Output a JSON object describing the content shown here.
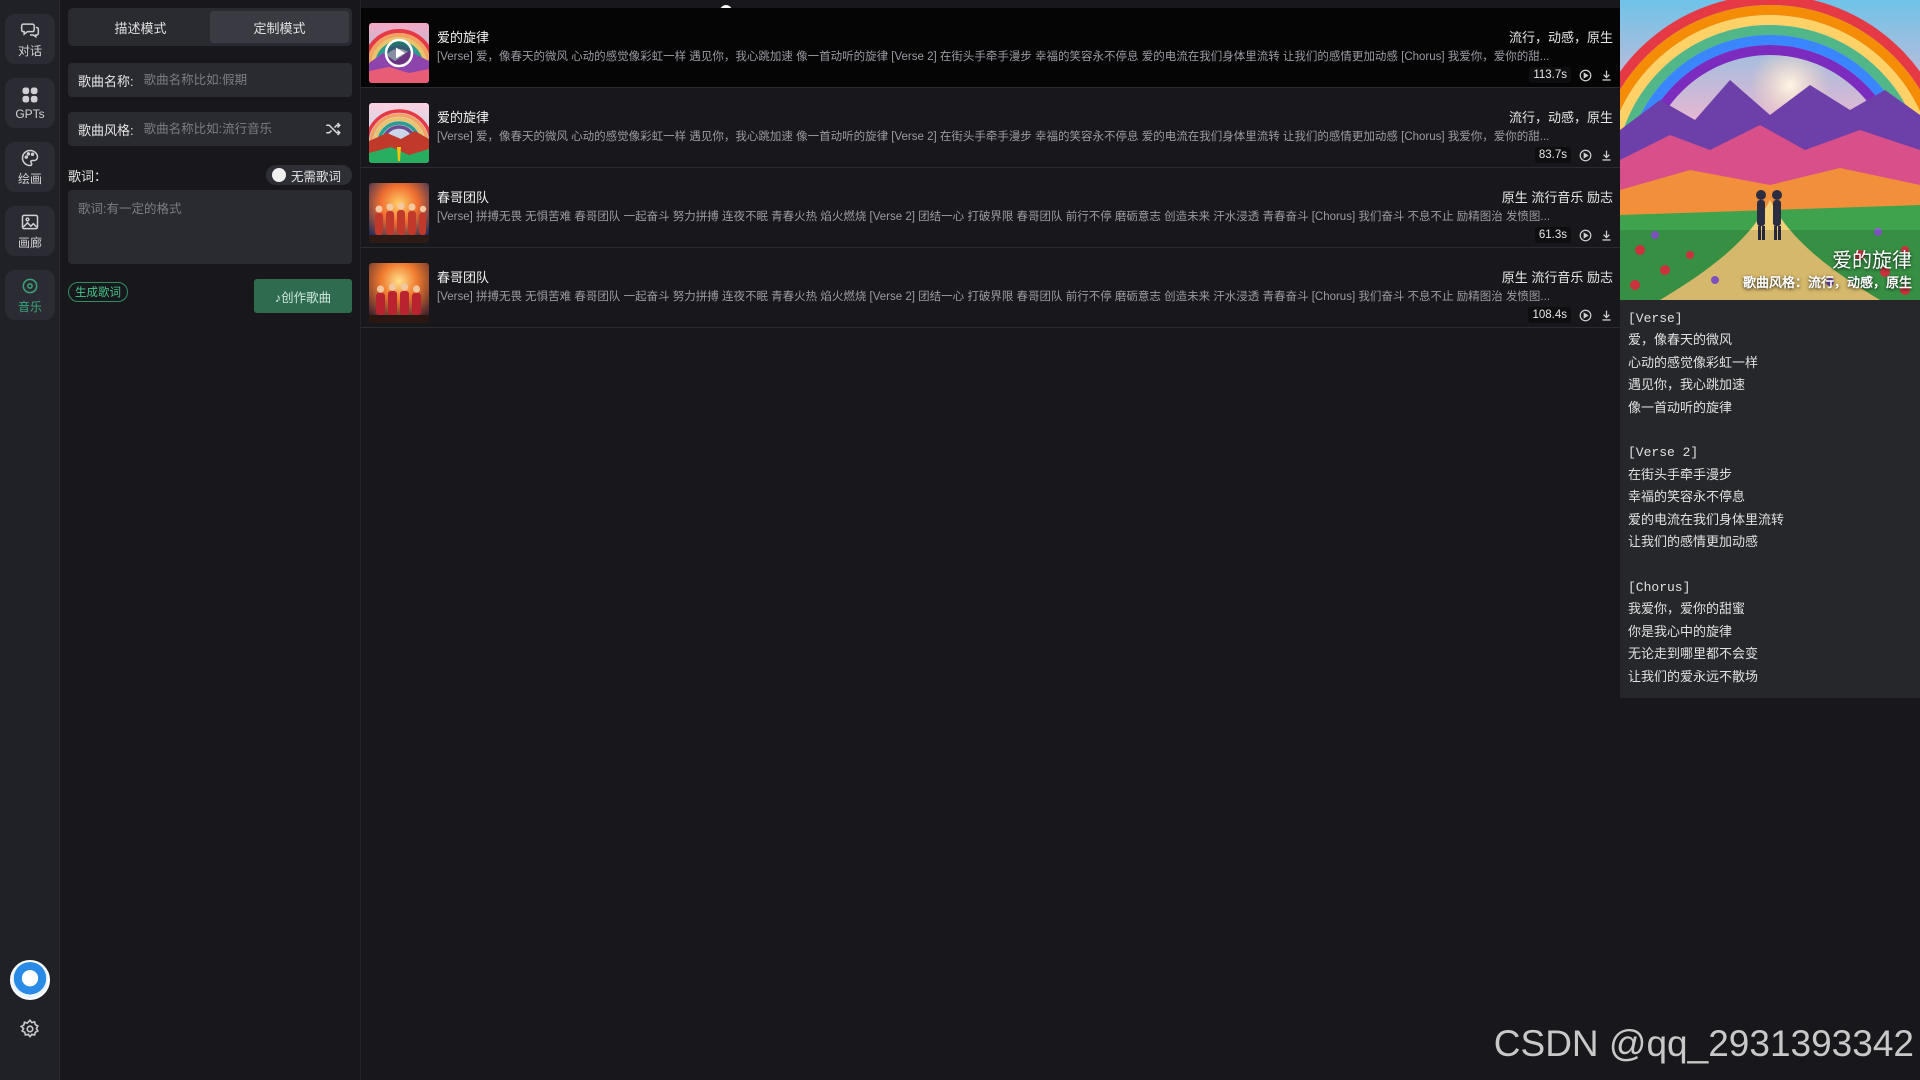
{
  "nav": {
    "items": [
      {
        "label": "对话",
        "icon": "chat-icon"
      },
      {
        "label": "GPTs",
        "icon": "grid-icon"
      },
      {
        "label": "绘画",
        "icon": "palette-icon"
      },
      {
        "label": "画廊",
        "icon": "image-icon"
      },
      {
        "label": "音乐",
        "icon": "music-icon",
        "active": true
      }
    ],
    "settings_icon": "gear-icon",
    "logo_icon": "app-logo-icon"
  },
  "form": {
    "tabs": [
      {
        "label": "描述模式"
      },
      {
        "label": "定制模式",
        "active": true
      }
    ],
    "song_name_label": "歌曲名称:",
    "song_name_placeholder": "歌曲名称比如:假期",
    "song_style_label": "歌曲风格:",
    "song_style_placeholder": "歌曲名称比如:流行音乐",
    "lyrics_label": "歌词：",
    "no_lyrics_toggle": "无需歌词",
    "lyrics_placeholder": "歌词:有一定的格式",
    "generate_lyrics_button": "生成歌词",
    "create_button": "♪创作歌曲"
  },
  "player": {
    "progress": 0.29
  },
  "songs": [
    {
      "title": "爱的旋律",
      "tags": "流行，动感，原生",
      "lyrics": "[Verse] 爱，像春天的微风 心动的感觉像彩虹一样 遇见你，我心跳加速 像一首动听的旋律 [Verse 2] 在街头手牵手漫步 幸福的笑容永不停息 爱的电流在我们身体里流转 让我们的感情更加动感 [Chorus] 我爱你，爱你的甜...",
      "duration": "113.7s",
      "playing": true
    },
    {
      "title": "爱的旋律",
      "tags": "流行，动感，原生",
      "lyrics": "[Verse] 爱，像春天的微风 心动的感觉像彩虹一样 遇见你，我心跳加速 像一首动听的旋律 [Verse 2] 在街头手牵手漫步 幸福的笑容永不停息 爱的电流在我们身体里流转 让我们的感情更加动感 [Chorus] 我爱你，爱你的甜...",
      "duration": "83.7s",
      "playing": false
    },
    {
      "title": "春哥团队",
      "tags": "原生 流行音乐 励志",
      "lyrics": "[Verse] 拼搏无畏 无惧苦难 春哥团队 一起奋斗 努力拼搏 连夜不眠 青春火热 焰火燃烧 [Verse 2] 团结一心 打破界限 春哥团队 前行不停 磨砺意志 创造未来 汗水浸透 青春奋斗 [Chorus] 我们奋斗 不息不止 励精图治 发愤图...",
      "duration": "61.3s",
      "playing": false
    },
    {
      "title": "春哥团队",
      "tags": "原生 流行音乐 励志",
      "lyrics": "[Verse] 拼搏无畏 无惧苦难 春哥团队 一起奋斗 努力拼搏 连夜不眠 青春火热 焰火燃烧 [Verse 2] 团结一心 打破界限 春哥团队 前行不停 磨砺意志 创造未来 汗水浸透 青春奋斗 [Chorus] 我们奋斗 不息不止 励精图治 发愤图...",
      "duration": "108.4s",
      "playing": false
    }
  ],
  "detail": {
    "title": "爱的旋律",
    "style": "歌曲风格：流行，动感，原生",
    "lyrics": "[Verse]\n爱，像春天的微风\n心动的感觉像彩虹一样\n遇见你，我心跳加速\n像一首动听的旋律\n\n[Verse 2]\n在街头手牵手漫步\n幸福的笑容永不停息\n爱的电流在我们身体里流转\n让我们的感情更加动感\n\n[Chorus]\n我爱你，爱你的甜蜜\n你是我心中的旋律\n无论走到哪里都不会变\n让我们的爱永远不散场"
  },
  "watermark": "CSDN @qq_2931393342",
  "colors": {
    "accent": "#37a57a",
    "background": "#18181c",
    "panel": "#2a2b31"
  }
}
